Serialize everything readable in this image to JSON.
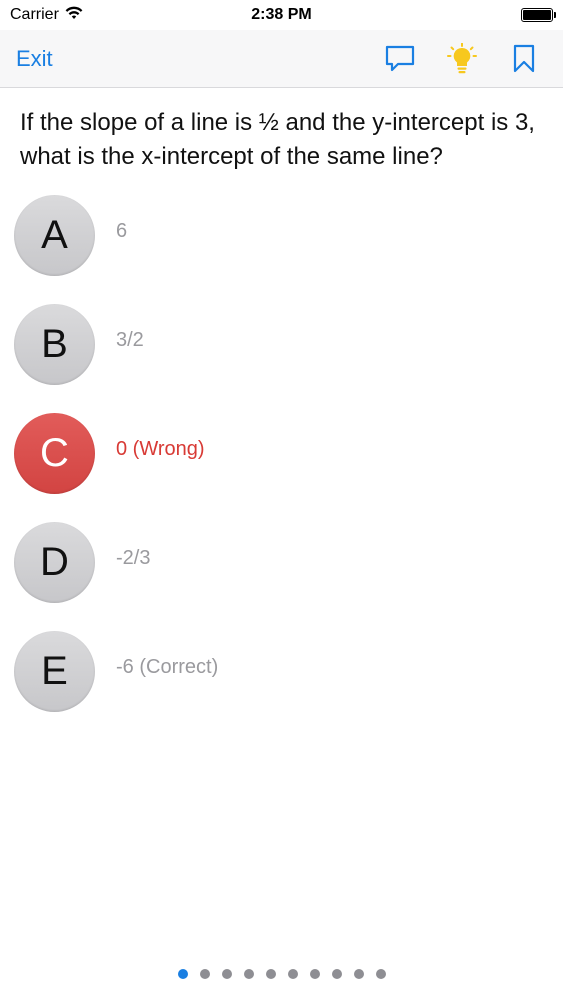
{
  "status_bar": {
    "carrier": "Carrier",
    "time": "2:38 PM"
  },
  "nav": {
    "exit_label": "Exit",
    "icons": [
      "comment-icon",
      "lightbulb-icon",
      "bookmark-icon"
    ]
  },
  "question": {
    "text": "If the slope of a line is ½ and the y-intercept is 3, what is the x-intercept of the same line?"
  },
  "answers": [
    {
      "letter": "A",
      "text": "6",
      "state": "normal"
    },
    {
      "letter": "B",
      "text": "3/2",
      "state": "normal"
    },
    {
      "letter": "C",
      "text": "0 (Wrong)",
      "state": "wrong"
    },
    {
      "letter": "D",
      "text": "-2/3",
      "state": "normal"
    },
    {
      "letter": "E",
      "text": "-6 (Correct)",
      "state": "normal"
    }
  ],
  "pagination": {
    "total": 10,
    "current": 1
  },
  "colors": {
    "accent": "#1a7fe2",
    "wrong": "#d83a35",
    "lightbulb": "#f7c81e"
  }
}
